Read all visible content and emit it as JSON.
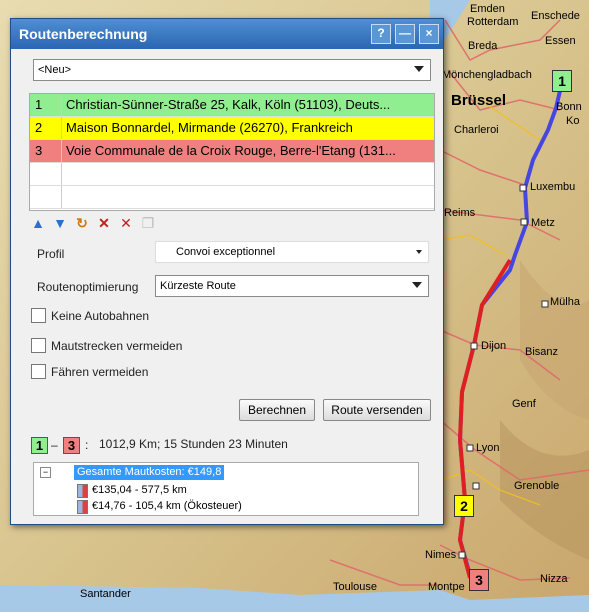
{
  "dialog": {
    "title": "Routenberechnung",
    "help_btn": "?",
    "min_btn": "—",
    "close_btn": "×",
    "route_select": "<Neu>",
    "stops": [
      {
        "num": "1",
        "text": "Christian-Sünner-Straße 25, Kalk, Köln (51103), Deuts...",
        "color": "#90ee90"
      },
      {
        "num": "2",
        "text": "Maison Bonnardel, Mirmande (26270), Frankreich",
        "color": "#ffff00"
      },
      {
        "num": "3",
        "text": "Voie Communale de la Croix Rouge, Berre-l'Etang (131...",
        "color": "#f08080"
      }
    ],
    "profil_label": "Profil",
    "profil_value": "Convoi exceptionnel",
    "opt_label": "Routenoptimierung",
    "opt_value": "Kürzeste Route",
    "opt_keine_autobahnen": "Keine Autobahnen",
    "opt_maut": "Mautstrecken vermeiden",
    "opt_faehren": "Fähren vermeiden",
    "btn_berechnen": "Berechnen",
    "btn_versenden": "Route versenden",
    "summary_from": "1",
    "summary_dash": "–",
    "summary_to": "3",
    "summary_colon": ":",
    "summary_text": "1012,9 Km; 15 Stunden 23 Minuten",
    "tree_root": "Gesamte Mautkosten: €149,8",
    "tree_items": [
      "€135,04 - 577,5 km",
      "€14,76 - 105,4 km (Ökosteuer)"
    ],
    "tree_toggle": "−"
  },
  "map": {
    "cities": [
      "Emden",
      "Rotterdam",
      "Enschede",
      "Breda",
      "Essen",
      "Mönchengladbach",
      "Brüssel",
      "Bonn",
      "Charleroi",
      "Ko",
      "Luxembu",
      "Reims",
      "Metz",
      "Mülha",
      "Dijon",
      "Bisanz",
      "Genf",
      "Lyon",
      "Grenoble",
      "Nimes",
      "Nizza",
      "Toulouse",
      "Montpe",
      "Santander"
    ],
    "marker_labels": [
      "1",
      "2",
      "3"
    ]
  }
}
